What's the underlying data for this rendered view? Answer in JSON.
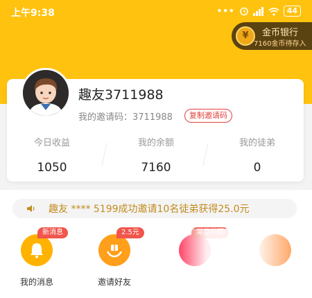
{
  "status_bar": {
    "time": "上午9:38",
    "dots": "•••",
    "battery": "44"
  },
  "bank": {
    "icon": "coin-icon",
    "title": "金币银行",
    "subtitle": "7160金币待存入"
  },
  "profile": {
    "username": "趣友3711988",
    "invite_code_text": "我的邀请码：3711988",
    "copy_button_label": "复制邀请码"
  },
  "stats": [
    {
      "label": "今日收益",
      "value": "1050"
    },
    {
      "label": "我的余额",
      "value": "7160"
    },
    {
      "label": "我的徒弟",
      "value": "0"
    }
  ],
  "ticker": {
    "icon": "speaker-icon",
    "text": "趣友 **** 5199成功邀请10名徒弟获得25.0元"
  },
  "features": [
    {
      "name": "我的消息",
      "badge": "新消息",
      "icon": "bell-icon",
      "color": "#ffb300"
    },
    {
      "name": "邀请好友",
      "badge": "2.5元",
      "icon": "gift-hands-icon",
      "color": "#ff9f1a"
    },
    {
      "name": "",
      "badge": "常见问题",
      "icon": "help-icon",
      "color": "#ff4d6d"
    },
    {
      "name": "",
      "badge": "",
      "icon": "more-icon",
      "color": "#ff7a1a"
    }
  ],
  "colors": {
    "header": "#ffc20e",
    "accent_red": "#e0413a",
    "ticker_text": "#c28b1e"
  }
}
